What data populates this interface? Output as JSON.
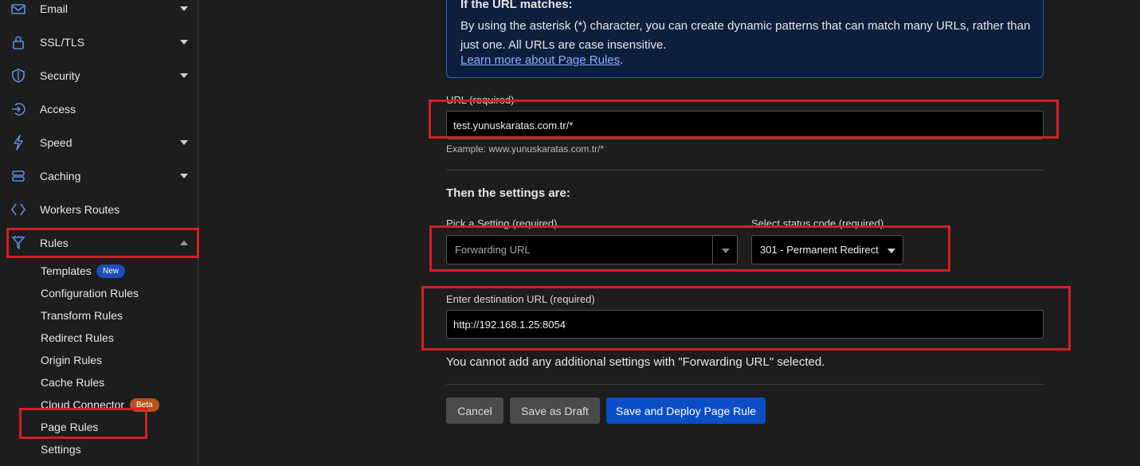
{
  "sidebar": {
    "items": [
      {
        "label": "Email",
        "icon": "email-icon"
      },
      {
        "label": "SSL/TLS",
        "icon": "lock-icon"
      },
      {
        "label": "Security",
        "icon": "shield-icon"
      },
      {
        "label": "Access",
        "icon": "access-icon"
      },
      {
        "label": "Speed",
        "icon": "lightning-icon"
      },
      {
        "label": "Caching",
        "icon": "database-icon"
      },
      {
        "label": "Workers Routes",
        "icon": "workers-icon"
      },
      {
        "label": "Rules",
        "icon": "rules-funnel-icon"
      }
    ],
    "rules_sub": [
      {
        "label": "Templates",
        "badge": "New"
      },
      {
        "label": "Configuration Rules"
      },
      {
        "label": "Transform Rules"
      },
      {
        "label": "Redirect Rules"
      },
      {
        "label": "Origin Rules"
      },
      {
        "label": "Cache Rules"
      },
      {
        "label": "Cloud Connector",
        "badge": "Beta"
      },
      {
        "label": "Page Rules"
      },
      {
        "label": "Settings"
      }
    ]
  },
  "info": {
    "title": "If the URL matches:",
    "text": "By using the asterisk (*) character, you can create dynamic patterns that can match many URLs, rather than just one. All URLs are case insensitive.",
    "link": "Learn more about Page Rules",
    "link_suffix": "."
  },
  "form": {
    "url_label": "URL (required)",
    "url_value": "test.yunuskaratas.com.tr/*",
    "url_example": "Example: www.yunuskaratas.com.tr/*",
    "settings_title": "Then the settings are:",
    "setting_label": "Pick a Setting (required)",
    "setting_value": "Forwarding URL",
    "status_label": "Select status code (required)",
    "status_value": "301 - Permanent Redirect",
    "dest_label": "Enter destination URL (required)",
    "dest_value": "http://192.168.1.25:8054",
    "note": "You cannot add any additional settings with \"Forwarding URL\" selected."
  },
  "buttons": {
    "cancel": "Cancel",
    "draft": "Save as Draft",
    "deploy": "Save and Deploy Page Rule"
  },
  "colors": {
    "annotation": "#d31f26",
    "primary": "#0a4ec7",
    "link": "#8ab0ff"
  }
}
